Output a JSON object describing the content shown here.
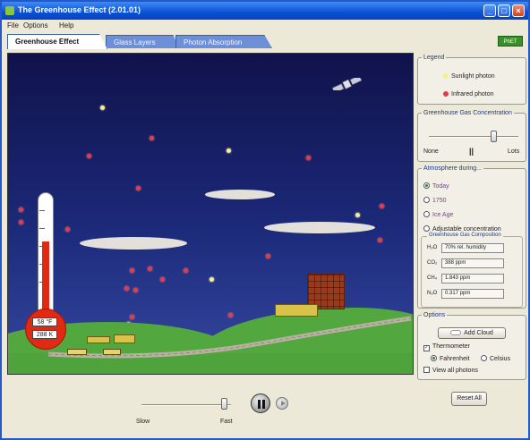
{
  "window": {
    "title": "The Greenhouse Effect (2.01.01)",
    "minimize_label": "_",
    "maximize_label": "□",
    "close_label": "×"
  },
  "menu": {
    "items": [
      "File",
      "Options",
      "Help"
    ]
  },
  "tabs": [
    {
      "label": "Greenhouse Effect",
      "active": true
    },
    {
      "label": "Glass Layers",
      "active": false
    },
    {
      "label": "Photon Absorption",
      "active": false
    }
  ],
  "logo": {
    "text": "PhET"
  },
  "sim": {
    "thermometer": {
      "readout_f": "58 °F",
      "readout_k": "288 K"
    }
  },
  "side": {
    "legend": {
      "title": "Legend",
      "sunlight_label": "Sunlight photon",
      "sunlight_color": "#f5f08a",
      "infrared_label": "Infrared photon",
      "infrared_color": "#e03c4c"
    },
    "concentration": {
      "title": "Greenhouse Gas Concentration",
      "min_label": "None",
      "max_label": "Lots",
      "level": 0.72
    },
    "atmosphere": {
      "title": "Atmosphere during...",
      "options": [
        {
          "label": "Today",
          "selected": true
        },
        {
          "label": "1750",
          "selected": false
        },
        {
          "label": "Ice Age",
          "selected": false
        },
        {
          "label": "Adjustable concentration",
          "selected": false
        }
      ],
      "composition_title": "Greenhouse Gas Composition",
      "gases": [
        {
          "name": "H₂O",
          "value": "70% rel. humidity"
        },
        {
          "name": "CO₂",
          "value": "388 ppm"
        },
        {
          "name": "CH₄",
          "value": "1.843 ppm"
        },
        {
          "name": "N₂O",
          "value": "0.317 ppm"
        }
      ]
    },
    "options": {
      "title": "Options",
      "add_clouds_label": "Add Cloud",
      "thermometer_label": "Thermometer",
      "thermometer_checked": true,
      "fahrenheit_label": "Fahrenheit",
      "celsius_label": "Celsius",
      "all_photons_label": "View all photons",
      "all_photons_checked": false
    },
    "reset_label": "Reset All"
  },
  "controls": {
    "speed_slow_label": "Slow",
    "speed_fast_label": "Fast",
    "speed_level": 0.92
  }
}
